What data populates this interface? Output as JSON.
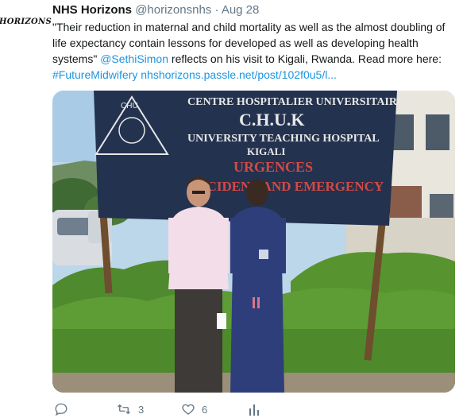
{
  "tweet": {
    "avatar_text": "HORIZONS",
    "display_name": "NHS Horizons",
    "handle": "@horizonsnhs",
    "separator": "·",
    "date": "Aug 28",
    "text_part1": "\"Their reduction in maternal and child mortality as well as the almost doubling of life expectancy contain lessons for developed as well as developing health systems\" ",
    "mention": "@SethiSimon",
    "text_part2": " reflects on his visit to Kigali, Rwanda. Read more here: ",
    "hashtag": "#FutureMidwifery",
    "url": "nhshorizons.passle.net/post/102f0u5/l..."
  },
  "photo": {
    "sign_line1": "CENTRE HOSPITALIER UNIVERSITAIRE",
    "sign_line2": "C.H.U.K",
    "sign_line3": "UNIVERSITY TEACHING HOSPITAL",
    "sign_line4": "KIGALI",
    "sign_line5": "URGENCES",
    "sign_line6": "ACCIDENT AND EMERGENCY",
    "logo_text": "CHU"
  },
  "actions": {
    "reply_count": "",
    "retweet_count": "3",
    "like_count": "6"
  },
  "colors": {
    "link": "#1b95e0",
    "muted": "#657786",
    "sign_blue": "#23324f",
    "sign_red": "#d24a45"
  }
}
